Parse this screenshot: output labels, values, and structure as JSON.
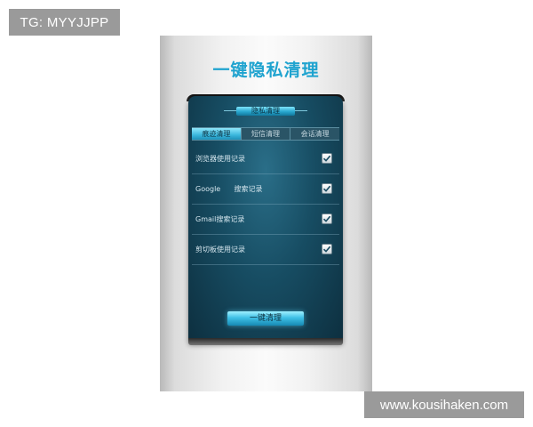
{
  "tag": "TG: MYYJJPP",
  "watermark": "www.kousihaken.com",
  "app": {
    "title": "一键隐私清理",
    "panel_title": "隐私清理",
    "tabs": [
      {
        "label": "痕迹清理",
        "active": true
      },
      {
        "label": "短信清理",
        "active": false
      },
      {
        "label": "会话清理",
        "active": false
      }
    ],
    "items": [
      {
        "label": "浏览器使用记录",
        "checked": true
      },
      {
        "label": "Google      搜索记录",
        "checked": true
      },
      {
        "label": "Gmail搜索记录",
        "checked": true
      },
      {
        "label": "剪切板使用记录",
        "checked": true
      }
    ],
    "clean_button": "一键清理"
  },
  "colors": {
    "title": "#1fa3cf",
    "panel": "#174d63",
    "accent": "#3bb7dd"
  }
}
